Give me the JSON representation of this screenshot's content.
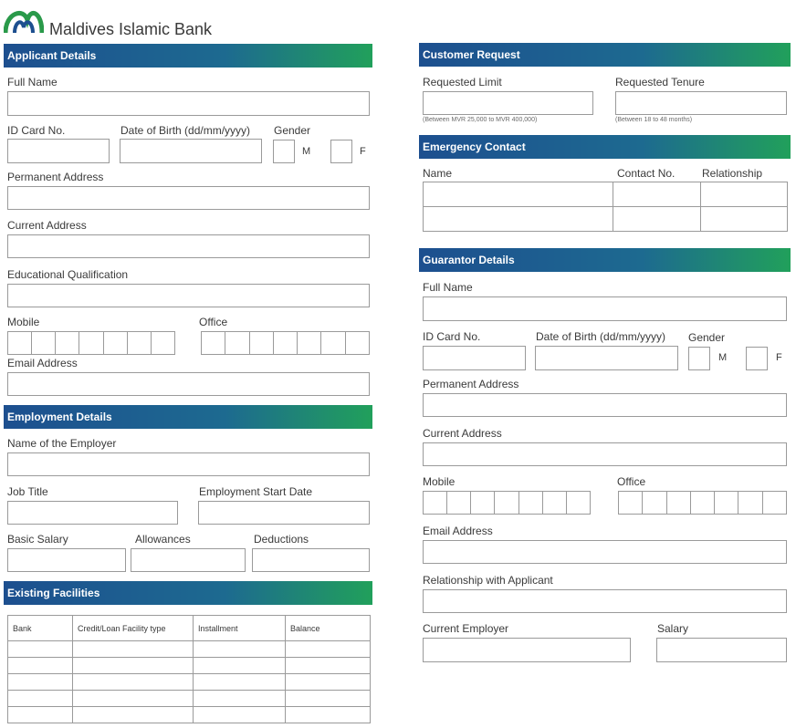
{
  "brand": {
    "name": "Maldives Islamic Bank"
  },
  "applicant": {
    "header": "Applicant Details",
    "full_name": "Full Name",
    "id_card": "ID Card No.",
    "dob": "Date of Birth (dd/mm/yyyy)",
    "gender": "Gender",
    "gender_m": "M",
    "gender_f": "F",
    "permanent_address": "Permanent Address",
    "current_address": "Current Address",
    "education": "Educational Qualification",
    "mobile": "Mobile",
    "office": "Office",
    "email": "Email Address"
  },
  "employment": {
    "header": "Employment Details",
    "employer": "Name of the Employer",
    "job_title": "Job Title",
    "start_date": "Employment Start Date",
    "basic_salary": "Basic Salary",
    "allowances": "Allowances",
    "deductions": "Deductions"
  },
  "facilities": {
    "header": "Existing Facilities",
    "columns": [
      "Bank",
      "Credit/Loan Facility type",
      "Installment",
      "Balance"
    ]
  },
  "request": {
    "header": "Customer Request",
    "limit": "Requested Limit",
    "limit_note": "(Between MVR 25,000 to MVR 400,000)",
    "tenure": "Requested Tenure",
    "tenure_note": "(Between 18 to 48 months)"
  },
  "emergency": {
    "header": "Emergency Contact",
    "name": "Name",
    "contact": "Contact No.",
    "relationship": "Relationship"
  },
  "guarantor": {
    "header": "Guarantor Details",
    "full_name": "Full Name",
    "id_card": "ID Card No.",
    "dob": "Date of Birth (dd/mm/yyyy)",
    "gender": "Gender",
    "gender_m": "M",
    "gender_f": "F",
    "permanent_address": "Permanent Address",
    "current_address": "Current Address",
    "mobile": "Mobile",
    "office": "Office",
    "email": "Email Address",
    "relationship": "Relationship with Applicant",
    "employer": "Current Employer",
    "salary": "Salary"
  },
  "colors": {
    "header_start": "#1d4f8f",
    "header_end": "#21a05b",
    "logo_green": "#2a9a4a",
    "logo_blue": "#1d4f8f"
  }
}
